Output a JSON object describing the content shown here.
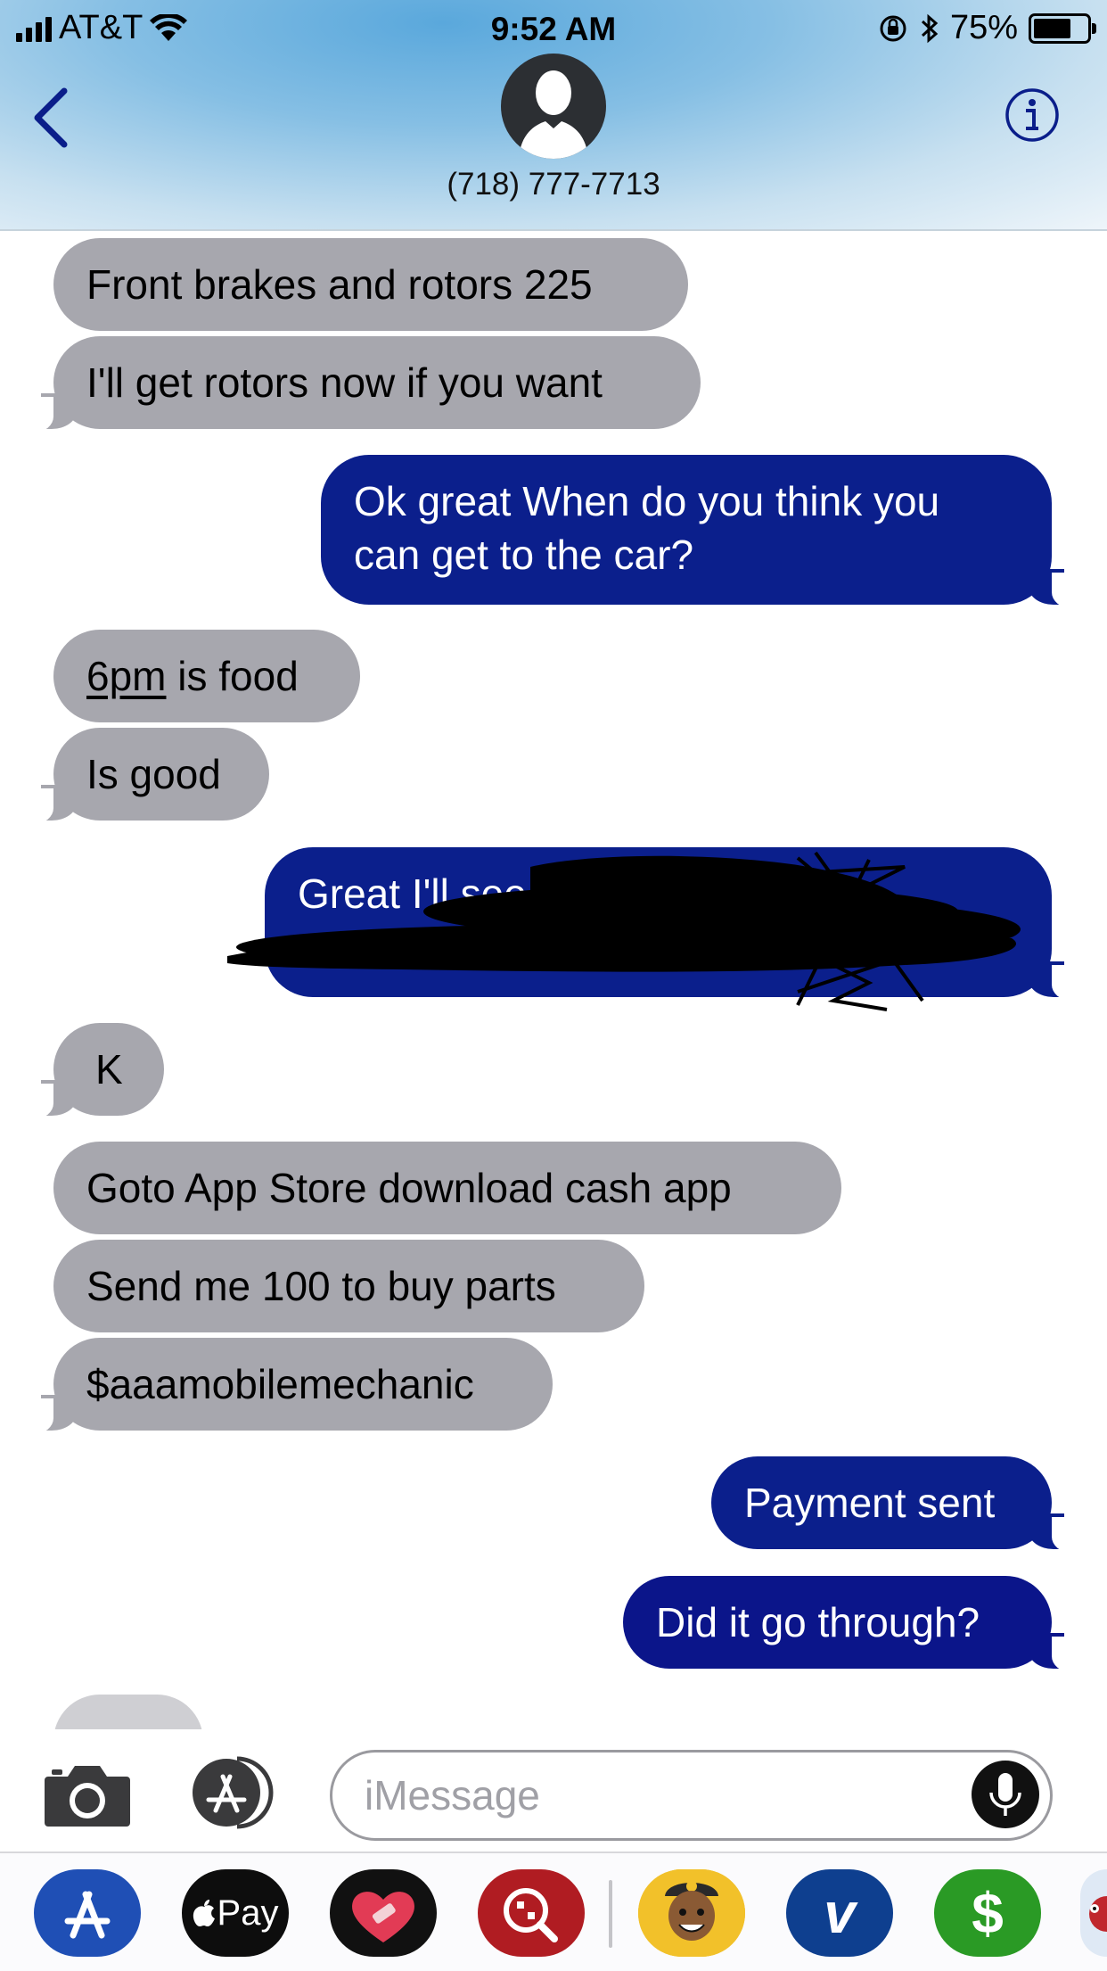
{
  "status_bar": {
    "carrier": "AT&T",
    "time": "9:52 AM",
    "battery": "75%",
    "battery_level": 0.75
  },
  "header": {
    "contact": "(718) 777-7713"
  },
  "colors": {
    "incoming_bubble": "#a7a7ae",
    "outgoing_bubble": "#0b1f8c",
    "accent": "#0a1e8a"
  },
  "messages": [
    {
      "dir": "in",
      "text": "Front brakes and rotors 225"
    },
    {
      "dir": "in",
      "text": "I'll get rotors now if you want"
    },
    {
      "dir": "out",
      "line1": "Ok great When do you think you",
      "line2": "can get to the car?"
    },
    {
      "dir": "in",
      "part1": "6pm",
      "part2": " is food"
    },
    {
      "dir": "in",
      "text": "Is good"
    },
    {
      "dir": "out",
      "text": "Great I'll see you then"
    },
    {
      "dir": "in",
      "text": "K"
    },
    {
      "dir": "in",
      "text": "Goto App Store download cash app"
    },
    {
      "dir": "in",
      "text": "Send me 100 to buy parts"
    },
    {
      "dir": "in",
      "text": "$aaamobilemechanic"
    },
    {
      "dir": "out",
      "text": "Payment sent"
    },
    {
      "dir": "out",
      "text": "Did it go through?"
    }
  ],
  "input": {
    "placeholder": "iMessage"
  },
  "app_drawer": {
    "apps": [
      "app-store-icon",
      "apple-pay-icon",
      "heart-sticker-icon",
      "image-search-icon",
      "bitmoji-icon",
      "venmo-icon",
      "cash-app-icon",
      "sticker-app-icon"
    ],
    "apple_pay_label": "Pay",
    "venmo_label": "v",
    "cash_label": "$"
  }
}
